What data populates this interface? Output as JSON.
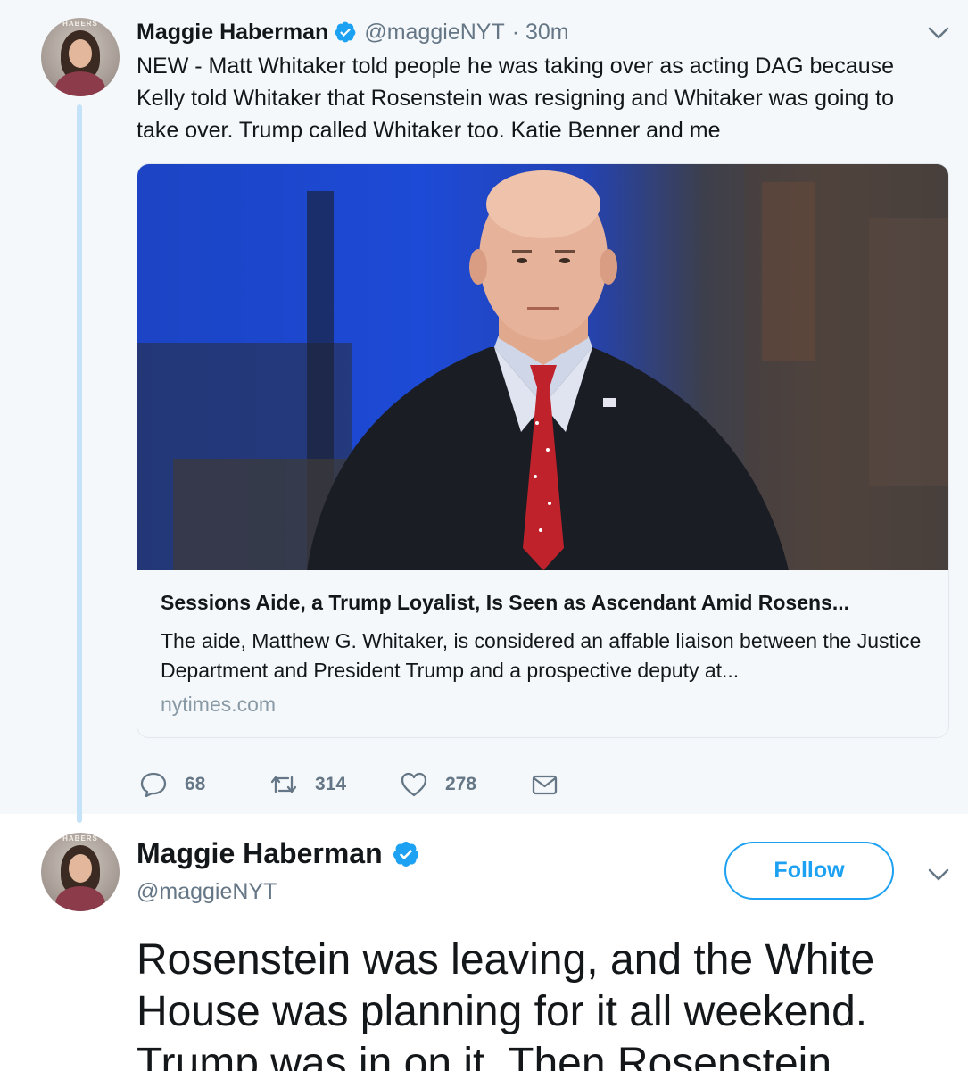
{
  "colors": {
    "brand": "#1da1f2",
    "text": "#14171a",
    "muted": "#657786",
    "thread_line": "#c4e3f8",
    "background_parent": "#f5f8fa"
  },
  "tweet1": {
    "author": {
      "name": "Maggie Haberman",
      "handle": "@maggieNYT",
      "verified": true,
      "avatar_text": "HABERS"
    },
    "timestamp": "· 30m",
    "text": "NEW - Matt Whitaker told people he was taking over as acting DAG because Kelly told Whitaker that Rosenstein was resigning and Whitaker was going to take over. Trump called Whitaker too. Katie Benner and me",
    "card": {
      "title": "Sessions Aide, a Trump Loyalist, Is Seen as Ascendant Amid Rosens...",
      "description": "The aide, Matthew G. Whitaker, is considered an affable liaison between the Justice Department and President Trump and a prospective deputy at...",
      "domain": "nytimes.com"
    },
    "actions": {
      "replies": "68",
      "retweets": "314",
      "likes": "278"
    },
    "icons": [
      "reply-icon",
      "retweet-icon",
      "like-icon",
      "dm-icon",
      "chevron-down-icon",
      "verified-icon"
    ]
  },
  "tweet2": {
    "author": {
      "name": "Maggie Haberman",
      "handle": "@maggieNYT",
      "verified": true,
      "avatar_text": "HABERS"
    },
    "follow_label": "Follow",
    "text": "Rosenstein was leaving, and the White House was planning for it all weekend. Trump was in on it. Then Rosenstein"
  }
}
